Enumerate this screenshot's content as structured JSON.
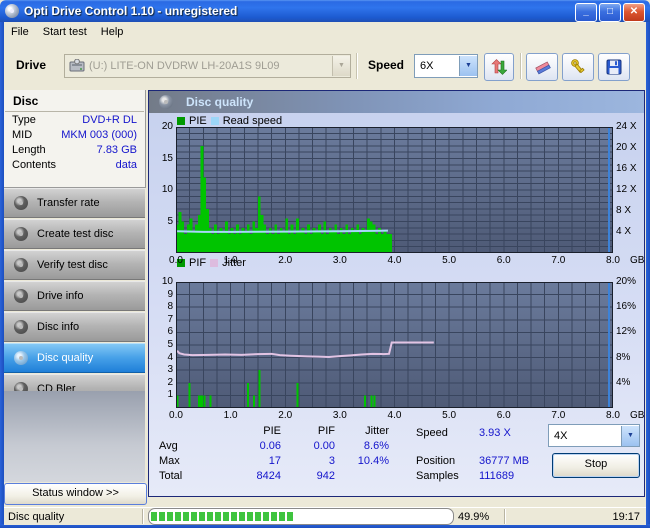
{
  "window": {
    "title": "Opti Drive Control 1.10 - unregistered"
  },
  "menu": {
    "items": [
      "File",
      "Start test",
      "Help"
    ]
  },
  "toolbar": {
    "drive_label": "Drive",
    "drive_value": "(U:)  LITE-ON DVDRW LH-20A1S 9L09",
    "speed_label": "Speed",
    "speed_value": "6X",
    "icons": [
      "refresh-arrows",
      "eraser",
      "register-keys",
      "save-floppy"
    ]
  },
  "disc_panel": {
    "title": "Disc",
    "rows": [
      {
        "label": "Type",
        "value": "DVD+R DL"
      },
      {
        "label": "MID",
        "value": "MKM 003 (000)"
      },
      {
        "label": "Length",
        "value": "7.83 GB"
      },
      {
        "label": "Contents",
        "value": "data"
      }
    ]
  },
  "sidebar": {
    "buttons": [
      {
        "label": "Transfer rate",
        "active": false
      },
      {
        "label": "Create test disc",
        "active": false
      },
      {
        "label": "Verify test disc",
        "active": false
      },
      {
        "label": "Drive info",
        "active": false
      },
      {
        "label": "Disc info",
        "active": false
      },
      {
        "label": "Disc quality",
        "active": true
      },
      {
        "label": "CD Bler",
        "active": false
      }
    ],
    "status_window_label": "Status window >>"
  },
  "main": {
    "header": "Disc quality"
  },
  "stats": {
    "columns": [
      "PIE",
      "PIF",
      "Jitter"
    ],
    "rows": [
      {
        "label": "Avg",
        "values": [
          "0.06",
          "0.00",
          "8.6%"
        ]
      },
      {
        "label": "Max",
        "values": [
          "17",
          "3",
          "10.4%"
        ]
      },
      {
        "label": "Total",
        "values": [
          "8424",
          "942",
          ""
        ]
      }
    ],
    "right": [
      {
        "label": "Speed",
        "value": "3.93 X"
      },
      {
        "label": "Position",
        "value": "36777 MB"
      },
      {
        "label": "Samples",
        "value": "111689"
      }
    ],
    "speed_select": "4X",
    "stop_label": "Stop"
  },
  "statusbar": {
    "left": "Disc quality",
    "percent": "49.9%",
    "time": "19:17",
    "progress_fraction": 0.499
  },
  "colors": {
    "pie_green": "#00c400",
    "legend_green": "#009900",
    "read_speed_blue": "#a6d9f8",
    "jitter_pink": "#e2c4e4",
    "marker_blue": "#3c82d8",
    "value_blue": "#1414cc",
    "active_button_blue": "#2a8ae0"
  },
  "chart_data": [
    {
      "type": "bar",
      "title": "PIE / Read speed",
      "legend": [
        {
          "label": "PIE",
          "color": "#009900"
        },
        {
          "label": "Read speed",
          "color": "#9cd6f8"
        }
      ],
      "xlabel": "GB",
      "xlim": [
        0,
        8
      ],
      "x_ticks": [
        0.0,
        1.0,
        2.0,
        3.0,
        4.0,
        5.0,
        6.0,
        7.0,
        8.0
      ],
      "ylim_left": [
        0,
        20
      ],
      "yticks_left": [
        20,
        15,
        10,
        5
      ],
      "right_axis_labels": [
        "24 X",
        "20 X",
        "16 X",
        "12 X",
        "8 X",
        "4 X"
      ],
      "marker_x": 7.93,
      "bars_x_start": 0,
      "bars_x_step": 0.05,
      "bars_values": [
        4.5,
        6.5,
        5,
        3,
        4.5,
        5.5,
        3.5,
        4.5,
        6,
        17,
        12,
        7,
        4,
        3,
        4.5,
        3,
        4,
        3.5,
        5,
        3,
        4,
        3,
        4.5,
        3,
        4,
        3.5,
        4.5,
        3,
        5,
        4,
        9,
        6,
        4.5,
        3,
        4,
        3,
        4.5,
        3,
        4,
        3.5,
        5.5,
        3,
        4.5,
        3,
        5.5,
        3.5,
        4,
        3,
        4.5,
        3,
        4,
        3.5,
        4.5,
        3,
        5,
        3,
        4,
        3.5,
        4.5,
        3,
        4,
        3,
        4.5,
        3,
        4,
        3.5,
        4.5,
        3,
        4,
        3.5,
        5.5,
        5,
        4.5,
        3,
        4,
        3,
        3.5,
        3,
        3
      ],
      "line_name": "Read speed",
      "line": [
        [
          0.02,
          3.45
        ],
        [
          0.5,
          3.35
        ],
        [
          1.0,
          3.35
        ],
        [
          2.0,
          3.4
        ],
        [
          3.0,
          3.45
        ],
        [
          3.88,
          3.55
        ]
      ]
    },
    {
      "type": "bar",
      "title": "PIF / Jitter",
      "legend": [
        {
          "label": "PIF",
          "color": "#009900"
        },
        {
          "label": "Jitter",
          "color": "#ddbcdf"
        }
      ],
      "xlabel": "GB",
      "xlim": [
        0,
        8
      ],
      "x_ticks": [
        0.0,
        1.0,
        2.0,
        3.0,
        4.0,
        5.0,
        6.0,
        7.0,
        8.0
      ],
      "ylim_left": [
        0,
        10
      ],
      "yticks_left": [
        10,
        9,
        8,
        7,
        6,
        5,
        4,
        3,
        2,
        1
      ],
      "right_axis_labels": [
        "20%",
        "16%",
        "12%",
        "8%",
        "4%"
      ],
      "marker_x": 7.93,
      "bars": [
        [
          0.03,
          1
        ],
        [
          0.25,
          2
        ],
        [
          0.42,
          1
        ],
        [
          0.45,
          1
        ],
        [
          0.48,
          1
        ],
        [
          0.52,
          1
        ],
        [
          0.63,
          1
        ],
        [
          1.32,
          2
        ],
        [
          1.43,
          1
        ],
        [
          1.53,
          3
        ],
        [
          2.22,
          2
        ],
        [
          3.46,
          1
        ],
        [
          3.58,
          1
        ],
        [
          3.63,
          1
        ]
      ],
      "line_name": "Jitter",
      "line": [
        [
          0.02,
          4.55
        ],
        [
          0.06,
          4.35
        ],
        [
          0.15,
          4.25
        ],
        [
          0.3,
          4.2
        ],
        [
          0.6,
          4.22
        ],
        [
          0.9,
          4.25
        ],
        [
          1.2,
          4.22
        ],
        [
          1.5,
          4.28
        ],
        [
          1.75,
          4.3
        ],
        [
          1.9,
          4.2
        ],
        [
          2.1,
          4.15
        ],
        [
          2.4,
          4.1
        ],
        [
          2.6,
          4.08
        ],
        [
          2.8,
          4.05
        ],
        [
          3.0,
          4.12
        ],
        [
          3.2,
          4.18
        ],
        [
          3.4,
          4.25
        ],
        [
          3.6,
          4.3
        ],
        [
          3.8,
          4.28
        ],
        [
          3.9,
          4.3
        ],
        [
          3.95,
          5.2
        ],
        [
          4.72,
          5.2
        ]
      ]
    }
  ]
}
